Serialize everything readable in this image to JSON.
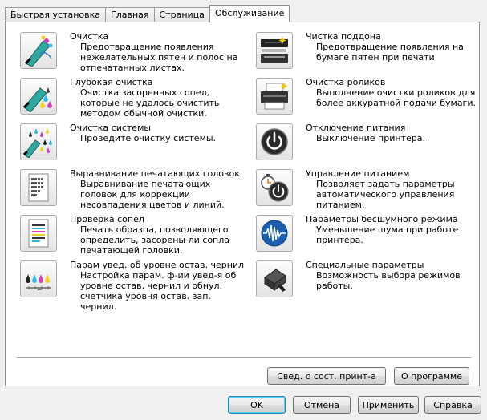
{
  "tabs": [
    {
      "label": "Быстрая установка"
    },
    {
      "label": "Главная"
    },
    {
      "label": "Страница"
    },
    {
      "label": "Обслуживание",
      "active": true
    }
  ],
  "left_items": [
    {
      "icon": "cleaning-icon",
      "title": "Очистка",
      "desc": "Предотвращение появления нежелательных пятен и полос на отпечатанных листах."
    },
    {
      "icon": "deep-cleaning-icon",
      "title": "Глубокая очистка",
      "desc": "Очистка засоренных сопел, которые не удалось очистить методом обычной очистки."
    },
    {
      "icon": "system-cleaning-icon",
      "title": "Очистка системы",
      "desc": "Проведите очистку системы."
    },
    {
      "icon": "head-alignment-icon",
      "title": "Выравнивание печатающих головок",
      "desc": "Выравнивание печатающих головок для коррекции несовпадения цветов и линий."
    },
    {
      "icon": "nozzle-check-icon",
      "title": "Проверка сопел",
      "desc": "Печать образца, позволяющего определить, засорены ли сопла печатающей головки."
    },
    {
      "icon": "ink-level-settings-icon",
      "title": "Парам увед. об уровне остав. чернил",
      "desc": "Настройка парам. ф-ии увед-я об уровне остав. чернил и обнул. счетчика уровня остав. зап. чернил."
    }
  ],
  "right_items": [
    {
      "icon": "bottom-plate-cleaning-icon",
      "title": "Чистка поддона",
      "desc": "Предотвращение появления на бумаге пятен при печати."
    },
    {
      "icon": "roller-cleaning-icon",
      "title": "Очистка роликов",
      "desc": "Выполнение очистки роликов для более аккуратной подачи бумаги."
    },
    {
      "icon": "power-off-icon",
      "title": "Отключение питания",
      "desc": "Выключение принтера."
    },
    {
      "icon": "auto-power-icon",
      "title": "Управление питанием",
      "desc": "Позволяет задать параметры автоматического управления питанием."
    },
    {
      "icon": "quiet-mode-icon",
      "title": "Параметры бесшумного режима",
      "desc": "Уменьшение шума при работе принтера."
    },
    {
      "icon": "custom-settings-icon",
      "title": "Специальные параметры",
      "desc": "Возможность выбора режимов работы."
    }
  ],
  "panel_buttons": {
    "status": "Свед. о сост. принт-а",
    "about": "О программе"
  },
  "dialog_buttons": {
    "ok": "OK",
    "cancel": "Отмена",
    "apply": "Применить",
    "help": "Справка"
  }
}
